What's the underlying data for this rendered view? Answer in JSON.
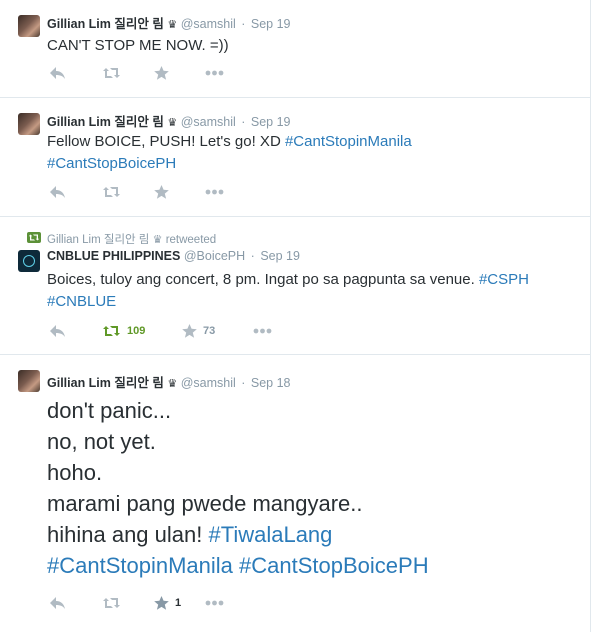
{
  "tweets": [
    {
      "user": {
        "name": "Gillian Lim 질리안 림",
        "crown": "♛",
        "handle": "@samshil"
      },
      "date": "Sep 19",
      "lines": [
        [
          {
            "t": "CAN'T STOP ME NOW. =))",
            "tag": false
          }
        ]
      ],
      "actions": {
        "retweets": "",
        "favorites": ""
      }
    },
    {
      "user": {
        "name": "Gillian Lim 질리안 림",
        "crown": "♛",
        "handle": "@samshil"
      },
      "date": "Sep 19",
      "lines": [
        [
          {
            "t": "Fellow BOICE, PUSH! Let's go! XD ",
            "tag": false
          },
          {
            "t": "#CantStopinManila",
            "tag": true
          }
        ],
        [
          {
            "t": "#CantStopBoicePH",
            "tag": true
          }
        ]
      ],
      "actions": {
        "retweets": "",
        "favorites": ""
      }
    },
    {
      "retweet_context": {
        "name": "Gillian Lim 질리안 림",
        "crown": "♛",
        "label": "retweeted"
      },
      "user": {
        "name": "CNBLUE PHILIPPINES",
        "crown": "",
        "handle": "@BoicePH"
      },
      "date": "Sep 19",
      "lines": [
        [
          {
            "t": "Boices, tuloy ang concert, 8 pm. Ingat po sa pagpunta sa venue. ",
            "tag": false
          },
          {
            "t": "#CSPH",
            "tag": true
          }
        ],
        [
          {
            "t": "#CNBLUE",
            "tag": true
          }
        ]
      ],
      "actions": {
        "retweets": "109",
        "favorites": "73"
      }
    },
    {
      "user": {
        "name": "Gillian Lim 질리안 림",
        "crown": "♛",
        "handle": "@samshil"
      },
      "date": "Sep 18",
      "lines": [
        [
          {
            "t": "don't panic...",
            "tag": false
          }
        ],
        [
          {
            "t": "no, not yet.",
            "tag": false
          }
        ],
        [
          {
            "t": "hoho.",
            "tag": false
          }
        ],
        [
          {
            "t": "marami pang pwede mangyare..",
            "tag": false
          }
        ],
        [
          {
            "t": "hihina ang ulan! ",
            "tag": false
          },
          {
            "t": "#TiwalaLang",
            "tag": true
          }
        ],
        [
          {
            "t": "#CantStopinManila",
            "tag": true
          },
          {
            "t": " ",
            "tag": false
          },
          {
            "t": "#CantStopBoicePH",
            "tag": true
          }
        ]
      ],
      "actions": {
        "retweets": "",
        "favorites": "1"
      }
    }
  ]
}
